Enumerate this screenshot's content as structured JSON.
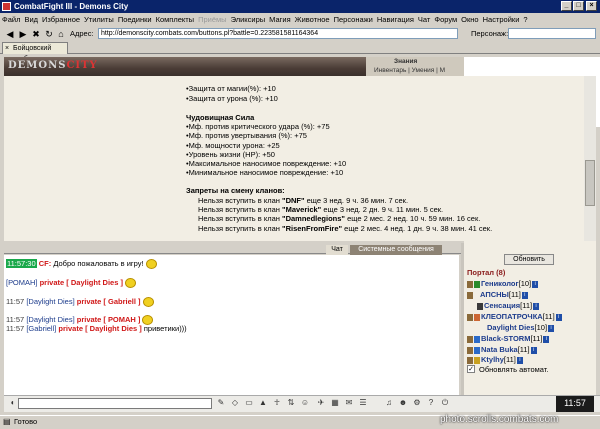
{
  "window": {
    "title": "CombatFight III - Demons City"
  },
  "menu": [
    "Файл",
    "Вид",
    "Избранное",
    "Утилиты",
    "Поединки",
    "Комплекты",
    "Приёмы",
    "Эликсиры",
    "Магия",
    "Животное",
    "Персонажи",
    "Навигация",
    "Чат",
    "Форум",
    "Окно",
    "Настройки",
    "?"
  ],
  "menu_disabled_index": 6,
  "address": {
    "label": "Адрес:",
    "url": "http://demonscity.combats.com/buttons.pl?battle=0.223581581164364"
  },
  "person": {
    "label": "Персонаж:"
  },
  "tab": {
    "label": "Бойцовский клуб"
  },
  "game": {
    "logo_prefix": "DEMONS",
    "logo_suffix": "CITY",
    "nav_main": "Знания",
    "nav_row": "Инвентарь | Умения | М"
  },
  "bonuses": [
    "Защита от магии(%): +10",
    "Защита от урона (%): +10"
  ],
  "strength": {
    "title": "Чудовищная Сила",
    "items": [
      "Мф. против критического удара (%): +75",
      "Мф. против увертывания (%): +75",
      "Мф. мощности урона: +25",
      "Уровень жизни (HP): +50",
      "Максимальное наносимое повреждение: +10",
      "Минимальное наносимое повреждение: +10"
    ]
  },
  "clan_ban": {
    "title": "Запреты на смену кланов:",
    "items": [
      {
        "pre": "Нельзя вступить в клан ",
        "clan": "\"DNF\"",
        "post": " еще 3 нед. 9 ч. 36 мин. 7 сек."
      },
      {
        "pre": "Нельзя вступить в клан ",
        "clan": "\"Maverick\"",
        "post": " еще 3 нед. 2 дн. 9 ч. 11 мин. 5 сек."
      },
      {
        "pre": "Нельзя вступить в клан ",
        "clan": "\"Damnedlegions\"",
        "post": " еще 2 мес. 2 нед. 10 ч. 59 мин. 16 сек."
      },
      {
        "pre": "Нельзя вступить в клан ",
        "clan": "\"RisenFromFire\"",
        "post": " еще 2 мес. 4 нед. 1 дн. 9 ч. 38 мин. 41 сек."
      }
    ]
  },
  "chat_tabs": {
    "chat": "Чат",
    "system": "Системные сообщения"
  },
  "chat": [
    {
      "time": "11:57:30",
      "sender": "CF:",
      "text": " Добро пожаловать в игру!"
    },
    {
      "time": "",
      "sender": "[РОМАН]",
      "private": " private [ Daylight Dies ]",
      "text": ""
    },
    {
      "time": "11:57",
      "sender": "[Daylight Dies]",
      "private": " private [ Gabriell ]",
      "text": ""
    },
    {
      "time": "11:57",
      "sender": "[Daylight Dies]",
      "private": " private [ РОМАН ]",
      "text": ""
    },
    {
      "time": "11:57",
      "sender": "[Gabriell]",
      "private": " private [ Daylight Dies ]",
      "text": " приветики)))"
    }
  ],
  "online": {
    "refresh_label": "Обновить",
    "title": "Портал (8)",
    "users": [
      {
        "name": "Гениколог",
        "level": "[10]"
      },
      {
        "name": "АПСНЫ",
        "level": "[11]"
      },
      {
        "name": "Сенсация",
        "level": "[11]"
      },
      {
        "name": "КЛЕОПАТРОЧКА",
        "level": "[11]"
      },
      {
        "name": "Daylight Dies",
        "level": "[10]"
      },
      {
        "name": "Black-STORM",
        "level": "[11]"
      },
      {
        "name": "Nata Buka",
        "level": "[11]"
      },
      {
        "name": "Ktylhy",
        "level": "[11]"
      }
    ],
    "auto_label": "Обновлять автомат."
  },
  "clock": "11:57",
  "status": "Готово",
  "watermark": "photo.scrolls.combats.com"
}
